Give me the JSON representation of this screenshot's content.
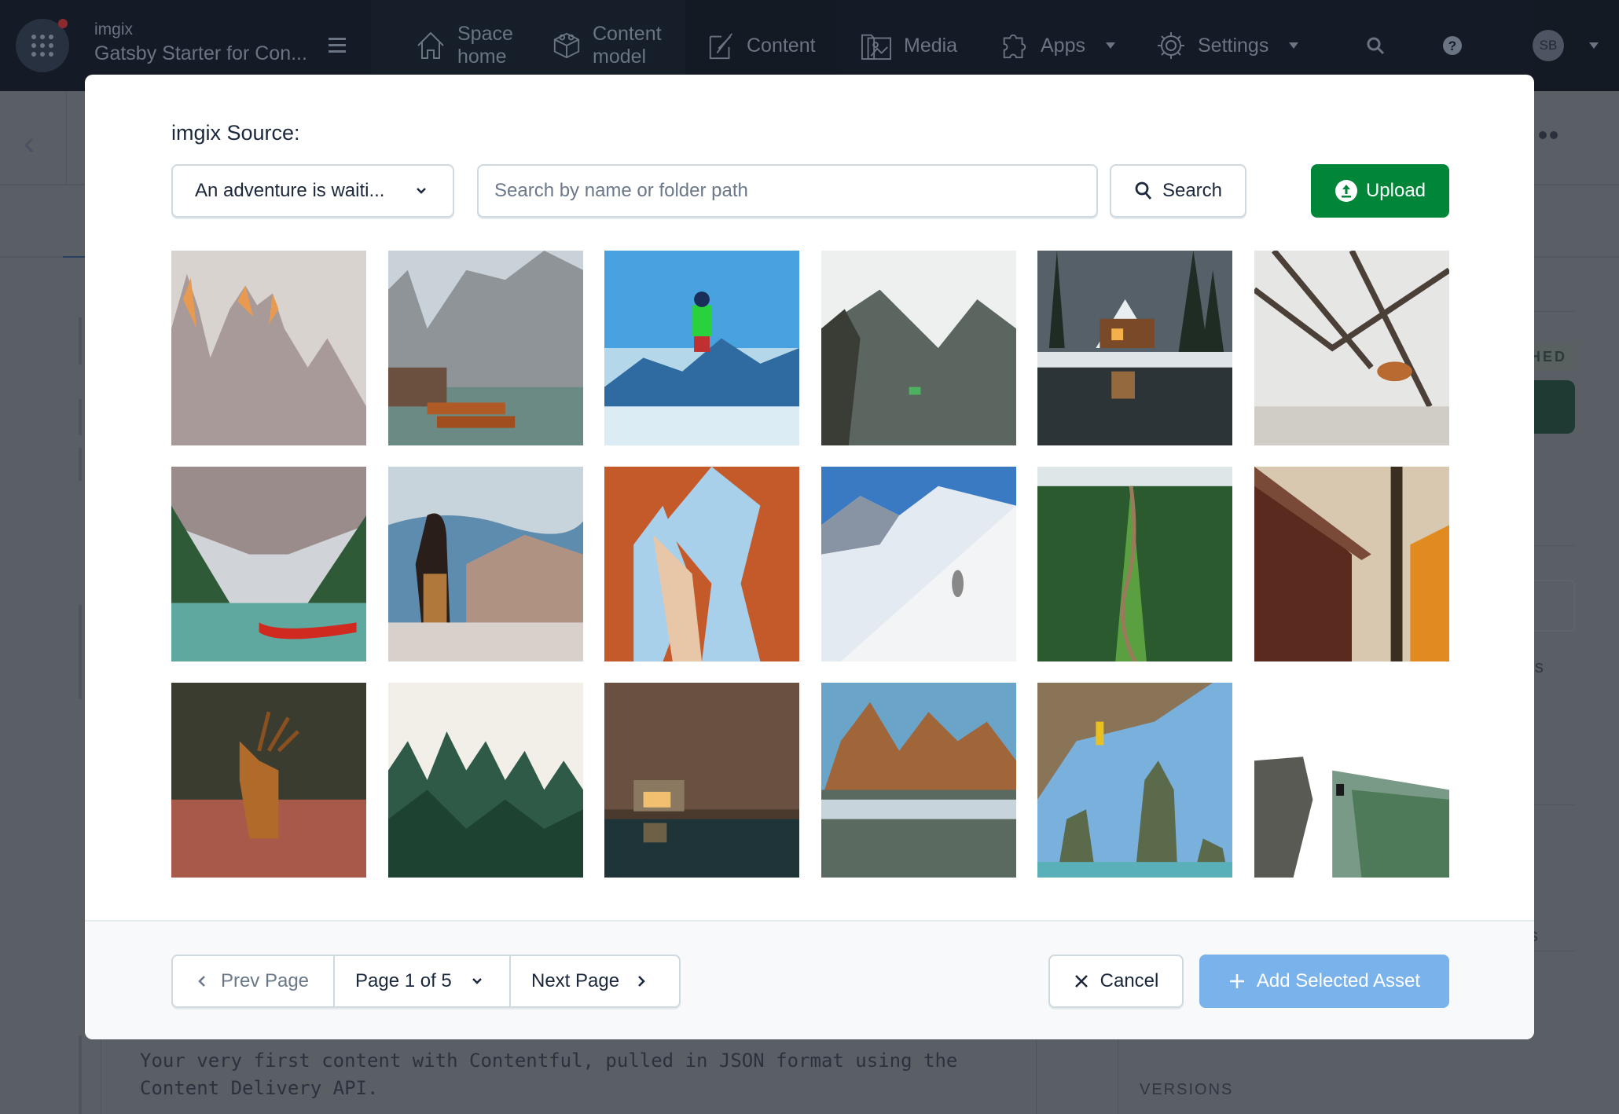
{
  "topnav": {
    "org_name": "imgix",
    "space_name": "Gatsby Starter for Con...",
    "items": [
      {
        "id": "space-home",
        "line1": "Space",
        "line2": "home",
        "icon": "home-icon"
      },
      {
        "id": "content-model",
        "line1": "Content",
        "line2": "model",
        "icon": "cube-icon"
      },
      {
        "id": "content",
        "label": "Content",
        "icon": "pen-icon"
      },
      {
        "id": "media",
        "label": "Media",
        "icon": "image-folder-icon"
      },
      {
        "id": "apps",
        "label": "Apps",
        "icon": "puzzle-icon",
        "dropdown": true
      },
      {
        "id": "settings",
        "label": "Settings",
        "icon": "gear-icon",
        "dropdown": true
      }
    ],
    "search_icon": "search-icon",
    "help_icon": "help-icon",
    "avatar_initials": "SB"
  },
  "background": {
    "status_badge": "HED",
    "side_text_1": "is",
    "side_text_2": "s",
    "description": "Your very first content with Contentful, pulled in JSON format using the Content Delivery API.",
    "versions_label": "VERSIONS"
  },
  "modal": {
    "source_label": "imgix Source:",
    "source_select_value": "An adventure is waiti...",
    "search_placeholder": "Search by name or folder path",
    "search_value": "",
    "search_button": "Search",
    "upload_button": "Upload",
    "assets": [
      {
        "subject": "mountain peaks at sunrise"
      },
      {
        "subject": "lake with wooden boats"
      },
      {
        "subject": "skier jumping over snowy mountains"
      },
      {
        "subject": "person on cliff edge in misty valley"
      },
      {
        "subject": "snowy cabin by lake"
      },
      {
        "subject": "fox in snowy forest"
      },
      {
        "subject": "mountain lake with red canoes"
      },
      {
        "subject": "hiker looking at mountains"
      },
      {
        "subject": "red rock arch"
      },
      {
        "subject": "skier on snowy slope"
      },
      {
        "subject": "green ridge trail aerial"
      },
      {
        "subject": "wooden cabin with autumn trees"
      },
      {
        "subject": "stag in forest"
      },
      {
        "subject": "misty pine forest"
      },
      {
        "subject": "forest cabin by lake"
      },
      {
        "subject": "autumn trees reflected in lake"
      },
      {
        "subject": "climber on overhang above sea stacks"
      },
      {
        "subject": "person sitting on rock ledge"
      }
    ],
    "footer": {
      "prev_page": "Prev Page",
      "page_select": "Page 1 of 5",
      "next_page": "Next Page",
      "cancel": "Cancel",
      "add_selected": "Add Selected Asset"
    }
  },
  "colors": {
    "primary_green": "#008539",
    "primary_blue_disabled": "#7ab2ec",
    "nav_bg": "#141b26",
    "overlay": "#5a5f66"
  }
}
